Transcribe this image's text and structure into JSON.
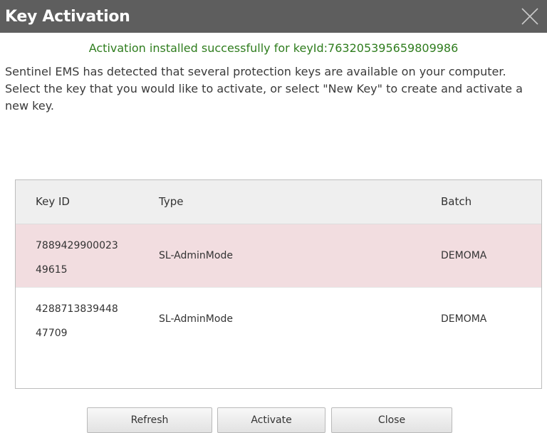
{
  "window": {
    "title": "Key Activation",
    "close_icon": "close-icon"
  },
  "success_message": "Activation installed successfully for keyId:763205395659809986",
  "description": "Sentinel EMS has detected that several protection keys are available on your computer. Select the key that you would like to activate, or select \"New Key\" to create and activate a new key.",
  "table": {
    "headers": [
      "Key ID",
      "Type",
      "Batch"
    ],
    "rows": [
      {
        "key_id_line1": "7889429900023",
        "key_id_line2": "49615",
        "type": "SL-AdminMode",
        "batch": "DEMOMA",
        "selected": true
      },
      {
        "key_id_line1": "4288713839448",
        "key_id_line2": "47709",
        "type": "SL-AdminMode",
        "batch": "DEMOMA",
        "selected": false
      }
    ]
  },
  "buttons": {
    "refresh": "Refresh",
    "activate": "Activate",
    "close": "Close"
  },
  "colors": {
    "titlebar": "#5e5e5e",
    "success_text": "#2f7d1e",
    "selected_row": "#f2dde0",
    "header_bg": "#efefef"
  }
}
